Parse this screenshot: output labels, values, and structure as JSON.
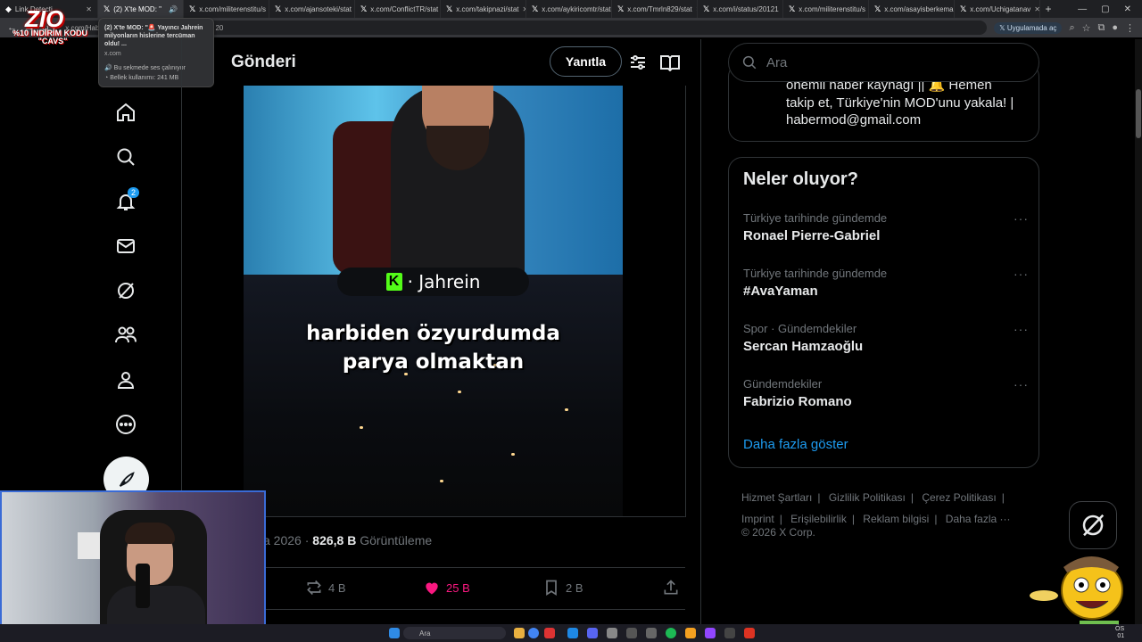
{
  "browser": {
    "tabs": [
      {
        "label": "Link Detecti",
        "active": false
      },
      {
        "label": "(2) X'te MOD: \"",
        "active": true
      },
      {
        "label": "x.com/militerenstitu/s",
        "active": false
      },
      {
        "label": "x.com/ajansoteki/stat",
        "active": false
      },
      {
        "label": "x.com/ConflictTR/stat",
        "active": false
      },
      {
        "label": "x.com/takipnazi/stat",
        "active": false
      },
      {
        "label": "x.com/aykiricomtr/stat",
        "active": false
      },
      {
        "label": "x.com/Tmrln829/stat",
        "active": false
      },
      {
        "label": "x.com/i/status/20121",
        "active": false
      },
      {
        "label": "x.com/militerenstitu/s",
        "active": false
      },
      {
        "label": "x.com/asayisberkemal",
        "active": false
      },
      {
        "label": "x.com/Uchigatanav",
        "active": false
      }
    ],
    "url_fragment": "x.com/Hab",
    "url_suffix": "20",
    "open_in_app": "Uygulamada aç",
    "tooltip": {
      "title": "(2) X'te MOD: \"🚨 Yayıncı Jahrein milyonların hislerine tercüman oldu! ...",
      "domain": "x.com",
      "audio": "Bu sekmede ses çalınıyor",
      "memory": "Bellek kullanımı: 241 MB"
    }
  },
  "overlay": {
    "logo_text": "ZIO",
    "promo": "%10 İNDİRİM KODU",
    "code": "\"CAVS\""
  },
  "nav": {
    "notification_count": "2"
  },
  "header": {
    "title": "Gönderi",
    "reply_label": "Yanıtla"
  },
  "media": {
    "streamer": "Jahrein",
    "caption_line1": "harbiden özyurdumda",
    "caption_line2": "parya olmaktan"
  },
  "post": {
    "date_partial": "ca 2026",
    "views": "826,8 B",
    "views_label": "Görüntüleme",
    "retweets": "4 B",
    "likes": "25 B",
    "bookmarks": "2 B"
  },
  "search": {
    "placeholder": "Ara"
  },
  "bio": {
    "line1": "önemli haber kaynağı || 🔔 Hemen",
    "line2": "takip et, Türkiye'nin MOD'unu yakala! |",
    "email": "habermod@gmail.com"
  },
  "trends": {
    "title": "Neler oluyor?",
    "items": [
      {
        "context": "Türkiye tarihinde gündemde",
        "name": "Ronael Pierre-Gabriel"
      },
      {
        "context": "Türkiye tarihinde gündemde",
        "name": "#AvaYaman"
      },
      {
        "context": "Spor · Gündemdekiler",
        "name": "Sercan Hamzaoğlu"
      },
      {
        "context": "Gündemdekiler",
        "name": "Fabrizio Romano"
      }
    ],
    "show_more": "Daha fazla göster"
  },
  "footer": {
    "links": [
      "Hizmet Şartları",
      "Gizlilik Politikası",
      "Çerez Politikası",
      "Imprint",
      "Erişilebilirlik",
      "Reklam bilgisi",
      "Daha fazla ···"
    ],
    "copyright": "© 2026 X Corp."
  },
  "taskbar": {
    "search_placeholder": "Ara"
  },
  "colors": {
    "accent": "#1d9bf0",
    "like": "#f91880",
    "kick": "#53fc18"
  }
}
